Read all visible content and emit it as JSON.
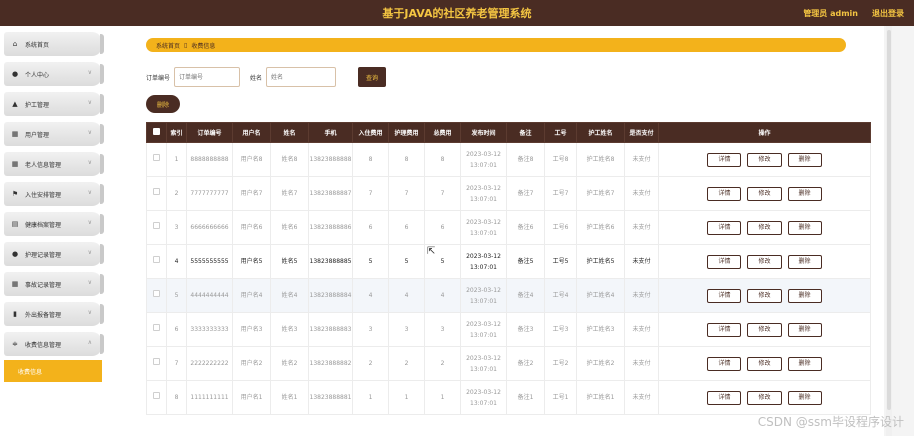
{
  "app": {
    "title": "基于JAVA的社区养老管理系统",
    "user": "管理员 admin",
    "logout": "退出登录"
  },
  "colors": {
    "header_bg": "#4a2c23",
    "accent": "#f3b21b",
    "title_text": "#f4c542"
  },
  "sidebar": {
    "items": [
      {
        "label": "系统首页",
        "icon": "home-icon"
      },
      {
        "label": "个人中心",
        "icon": "user-icon"
      },
      {
        "label": "护工管理",
        "icon": "caregiver-icon"
      },
      {
        "label": "用户管理",
        "icon": "grid-icon"
      },
      {
        "label": "老人信息管理",
        "icon": "grid-icon"
      },
      {
        "label": "入住安排管理",
        "icon": "flag-icon"
      },
      {
        "label": "健康档案管理",
        "icon": "table-icon"
      },
      {
        "label": "护理记录管理",
        "icon": "user-icon"
      },
      {
        "label": "事故记录管理",
        "icon": "grid-icon"
      },
      {
        "label": "外出报备管理",
        "icon": "document-icon"
      },
      {
        "label": "收费信息管理",
        "icon": "sliders-icon"
      }
    ],
    "active_sub": "收费信息"
  },
  "breadcrumb": {
    "home": "系统首页",
    "sep": "▯",
    "current": "收费信息"
  },
  "search": {
    "order_label": "订单编号",
    "order_placeholder": "订单编号",
    "name_label": "姓名",
    "name_placeholder": "姓名",
    "button": "查询"
  },
  "delete_button": "删除",
  "table": {
    "headers": [
      "索引",
      "订单编号",
      "用户名",
      "姓名",
      "手机",
      "入住费用",
      "护理费用",
      "总费用",
      "发布时间",
      "备注",
      "工号",
      "护工姓名",
      "是否支付",
      "操作"
    ],
    "ops": {
      "detail": "详情",
      "edit": "修改",
      "delete": "删除"
    },
    "rows": [
      [
        "1",
        "8888888888",
        "用户名8",
        "姓名8",
        "13823888888",
        "8",
        "8",
        "8",
        "2023-03-12 13:07:01",
        "备注8",
        "工号8",
        "护工姓名8",
        "未支付"
      ],
      [
        "2",
        "7777777777",
        "用户名7",
        "姓名7",
        "13823888887",
        "7",
        "7",
        "7",
        "2023-03-12 13:07:01",
        "备注7",
        "工号7",
        "护工姓名7",
        "未支付"
      ],
      [
        "3",
        "6666666666",
        "用户名6",
        "姓名6",
        "13823888886",
        "6",
        "6",
        "6",
        "2023-03-12 13:07:01",
        "备注6",
        "工号6",
        "护工姓名6",
        "未支付"
      ],
      [
        "4",
        "5555555555",
        "用户名5",
        "姓名5",
        "13823888885",
        "5",
        "5",
        "5",
        "2023-03-12 13:07:01",
        "备注5",
        "工号5",
        "护工姓名5",
        "未支付"
      ],
      [
        "5",
        "4444444444",
        "用户名4",
        "姓名4",
        "13823888884",
        "4",
        "4",
        "4",
        "2023-03-12 13:07:01",
        "备注4",
        "工号4",
        "护工姓名4",
        "未支付"
      ],
      [
        "6",
        "3333333333",
        "用户名3",
        "姓名3",
        "13823888883",
        "3",
        "3",
        "3",
        "2023-03-12 13:07:01",
        "备注3",
        "工号3",
        "护工姓名3",
        "未支付"
      ],
      [
        "7",
        "2222222222",
        "用户名2",
        "姓名2",
        "13823888882",
        "2",
        "2",
        "2",
        "2023-03-12 13:07:01",
        "备注2",
        "工号2",
        "护工姓名2",
        "未支付"
      ],
      [
        "8",
        "1111111111",
        "用户名1",
        "姓名1",
        "13823888881",
        "1",
        "1",
        "1",
        "2023-03-12 13:07:01",
        "备注1",
        "工号1",
        "护工姓名1",
        "未支付"
      ]
    ]
  },
  "watermark": "CSDN @ssm毕设程序设计"
}
